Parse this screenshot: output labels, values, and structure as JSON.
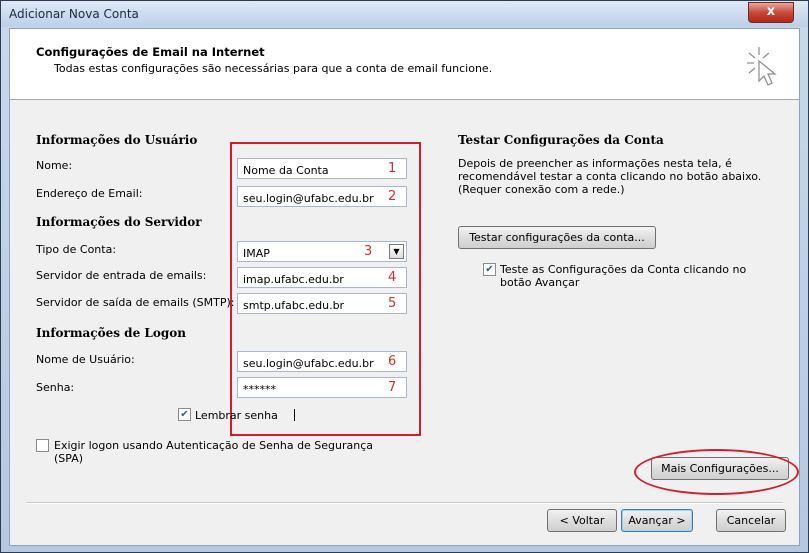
{
  "window": {
    "title": "Adicionar Nova Conta",
    "close_label": "x"
  },
  "header": {
    "title": "Configurações de Email na Internet",
    "subtitle": "Todas estas configurações são necessárias para que a conta de email funcione."
  },
  "user_info": {
    "heading": "Informações do Usuário",
    "name_label": "Nome:",
    "name_value": "Nome da Conta",
    "email_label": "Endereço de Email:",
    "email_value": "seu.login@ufabc.edu.br"
  },
  "server_info": {
    "heading": "Informações do Servidor",
    "account_type_label": "Tipo de Conta:",
    "account_type_value": "IMAP",
    "incoming_label": "Servidor de entrada de emails:",
    "incoming_value": "imap.ufabc.edu.br",
    "outgoing_label": "Servidor de saída de emails (SMTP):",
    "outgoing_value": "smtp.ufabc.edu.br"
  },
  "logon_info": {
    "heading": "Informações de Logon",
    "username_label": "Nome de Usuário:",
    "username_value": "seu.login@ufabc.edu.br",
    "password_label": "Senha:",
    "password_value": "******",
    "remember_label": "Lembrar senha",
    "spa_label": "Exigir logon usando Autenticação de Senha de Segurança (SPA)"
  },
  "annotations": {
    "numbers": [
      "1",
      "2",
      "3",
      "4",
      "5",
      "6",
      "7"
    ],
    "color": "#d21e2b"
  },
  "test": {
    "heading": "Testar Configurações da Conta",
    "description": "Depois de preencher as informações nesta tela, é recomendável testar a conta clicando no botão abaixo. (Requer conexão com a rede.)",
    "test_button": "Testar configurações da conta...",
    "auto_test_label": "Teste as Configurações da Conta clicando no botão Avançar"
  },
  "more_settings_button": "Mais Configurações...",
  "footer": {
    "back": "< Voltar",
    "next": "Avançar >",
    "cancel": "Cancelar"
  }
}
